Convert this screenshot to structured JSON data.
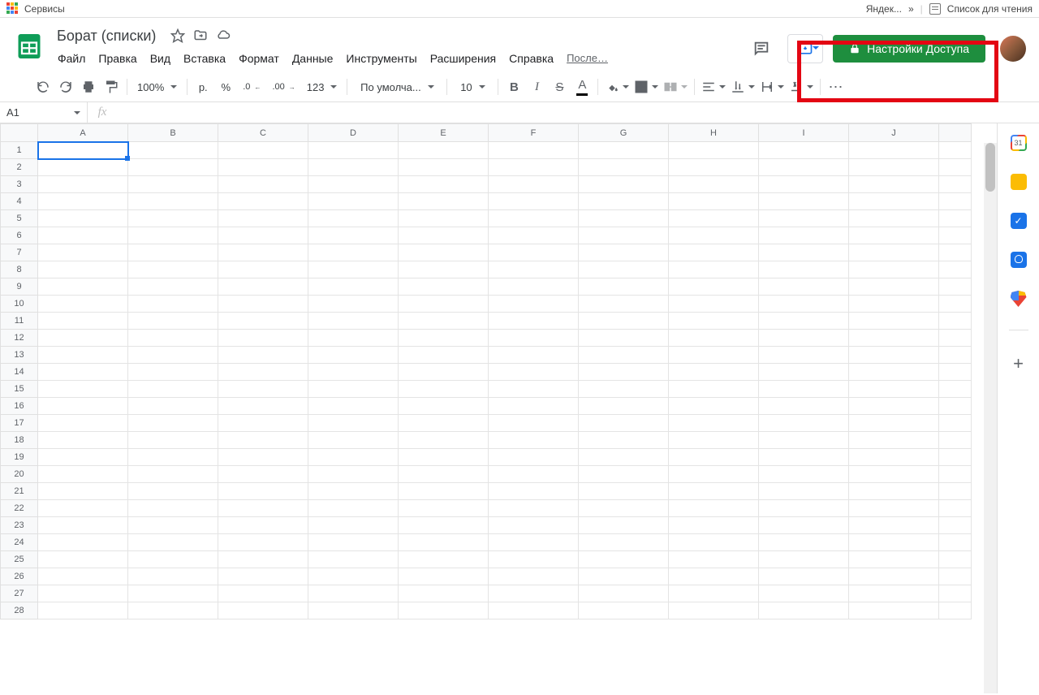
{
  "chrome": {
    "services": "Сервисы",
    "yandex": "Яндек...",
    "chevron": "»",
    "reading_list": "Список для чтения"
  },
  "doc": {
    "title": "Борат (списки)"
  },
  "menu": {
    "file": "Файл",
    "edit": "Правка",
    "view": "Вид",
    "insert": "Вставка",
    "format": "Формат",
    "data": "Данные",
    "tools": "Инструменты",
    "extensions": "Расширения",
    "help": "Справка",
    "last_edit": "После…"
  },
  "share": {
    "label": "Настройки Доступа"
  },
  "toolbar": {
    "zoom": "100%",
    "currency": "р.",
    "percent": "%",
    "dec_dec": ".0",
    "dec_inc": ".00",
    "numfmt": "123",
    "font": "По умолча...",
    "font_size": "10",
    "text_color_letter": "A",
    "more": "⋯"
  },
  "name_box": {
    "ref": "A1"
  },
  "fx": "fx",
  "columns": [
    "A",
    "B",
    "C",
    "D",
    "E",
    "F",
    "G",
    "H",
    "I",
    "J"
  ],
  "row_count": 28,
  "selected": {
    "row": 1,
    "col": 0
  },
  "sidepanel": {
    "calendar_day": "31"
  }
}
